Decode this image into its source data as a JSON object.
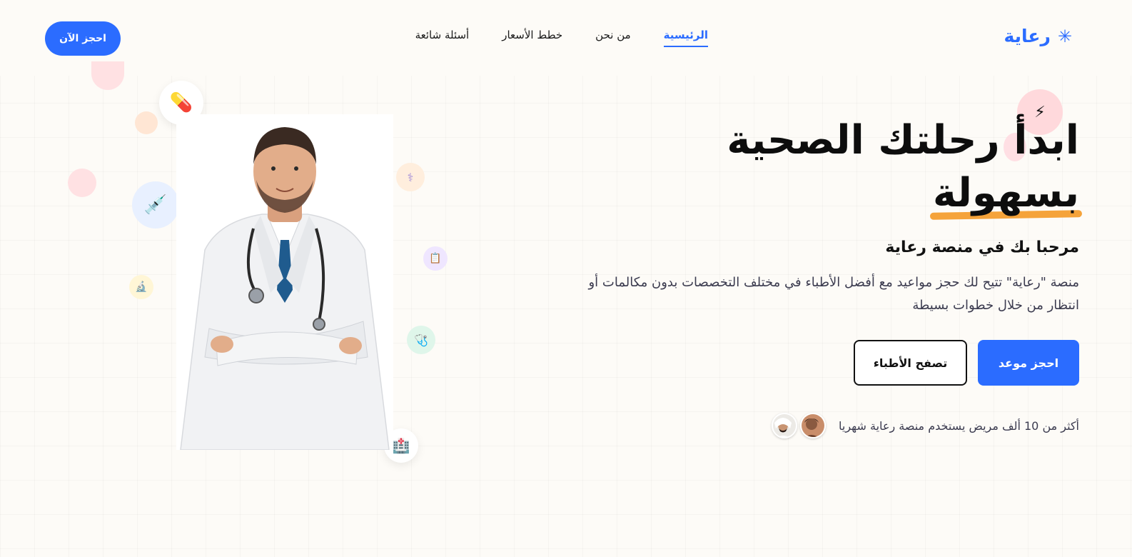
{
  "header": {
    "logo_text": "رعاية",
    "logo_icon": "asterisk-icon",
    "nav": [
      {
        "label": "الرئيسية",
        "active": true
      },
      {
        "label": "من نحن",
        "active": false
      },
      {
        "label": "خطط الأسعار",
        "active": false
      },
      {
        "label": "أسئلة شائعة",
        "active": false
      }
    ],
    "cta_label": "احجز الآن"
  },
  "hero": {
    "title_line1": "ابدأ رحلتك الصحية",
    "title_line2": "بسهولة",
    "subtitle": "مرحبا بك في منصة رعاية",
    "description": "منصة \"رعاية\" تتيح لك حجز مواعيد مع أفضل الأطباء في مختلف التخصصات بدون مكالمات أو انتظار من خلال خطوات بسيطة",
    "primary_button": "احجز موعد",
    "secondary_button": "تصفح الأطباء",
    "social_proof": "أكثر من 10 ألف مريض يستخدم منصة رعاية شهريا"
  },
  "decor_icons": [
    "pill-icon",
    "syringe-icon",
    "caduceus-icon",
    "clipboard-icon",
    "microscope-icon",
    "stethoscope-icon",
    "hospital-icon",
    "lightning-icon"
  ],
  "colors": {
    "accent": "#2b6cff",
    "highlight": "#f5a33a",
    "background": "#fdfbf7"
  }
}
